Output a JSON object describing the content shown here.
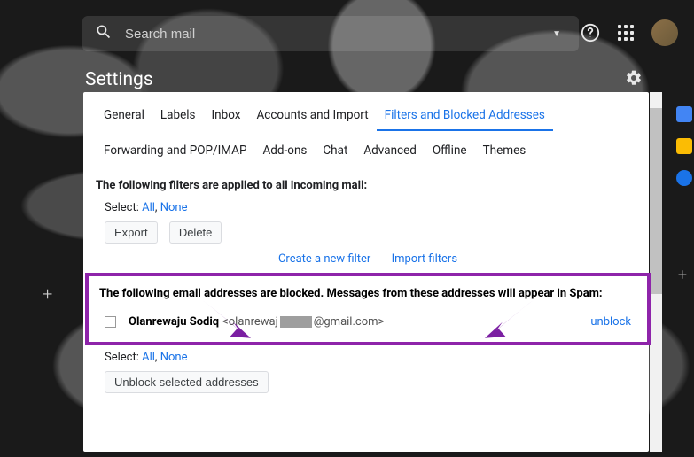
{
  "search": {
    "placeholder": "Search mail"
  },
  "header": {
    "title": "Settings"
  },
  "tabs": {
    "row1": [
      "General",
      "Labels",
      "Inbox",
      "Accounts and Import",
      "Filters and Blocked Addresses"
    ],
    "row2": [
      "Forwarding and POP/IMAP",
      "Add-ons",
      "Chat",
      "Advanced",
      "Offline",
      "Themes"
    ],
    "active": "Filters and Blocked Addresses"
  },
  "filters": {
    "title": "The following filters are applied to all incoming mail:",
    "select_label": "Select:",
    "select_all": "All",
    "select_sep": ", ",
    "select_none": "None",
    "export_btn": "Export",
    "delete_btn": "Delete",
    "create_link": "Create a new filter",
    "import_link": "Import filters"
  },
  "blocked": {
    "title": "The following email addresses are blocked. Messages from these addresses will appear in Spam:",
    "entries": [
      {
        "name": "Olanrewaju Sodiq",
        "email_prefix": "<olanrewaj",
        "email_suffix": "@gmail.com>",
        "unblock": "unblock"
      }
    ],
    "select_label": "Select:",
    "select_all": "All",
    "select_sep": ", ",
    "select_none": "None",
    "unblock_selected_btn": "Unblock selected addresses"
  }
}
